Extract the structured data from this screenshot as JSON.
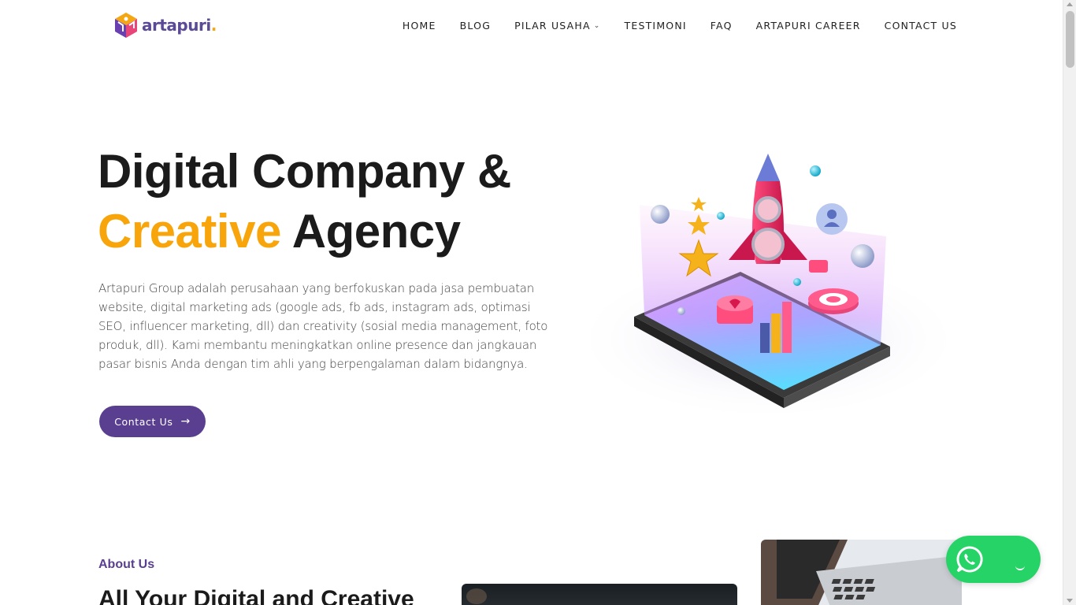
{
  "brand": {
    "name": "artapuri",
    "dot": ".",
    "logo_icon": "artapuri-cube-logo"
  },
  "nav": {
    "items": [
      {
        "label": "HOME"
      },
      {
        "label": "BLOG"
      },
      {
        "label": "PILAR USAHA",
        "has_dropdown": true
      },
      {
        "label": "TESTIMONI"
      },
      {
        "label": "FAQ"
      },
      {
        "label": "ARTAPURI CAREER"
      },
      {
        "label": "CONTACT US"
      }
    ],
    "dropdown_icon": "chevron-down-icon"
  },
  "hero": {
    "title_line1": "Digital Company &",
    "title_accent": "Creative",
    "title_rest": "Agency",
    "description": "Artapuri Group adalah perusahaan yang berfokuskan pada jasa pembuatan website, digital marketing ads (google ads, fb ads, instagram ads, optimasi SEO, influencer marketing, dll) dan creativity (sosial media management, foto produk, dll). Kami membantu meningkatkan online presence dan jangkauan pasar bisnis Anda dengan tim ahli yang berpengalaman dalam bidangnya.",
    "cta_label": "Contact Us",
    "cta_icon": "arrow-right-icon",
    "illustration": "rocket-on-tablet-illustration"
  },
  "about": {
    "label": "About Us",
    "heading": "All Your Digital and Creative"
  },
  "whatsapp": {
    "icon": "whatsapp-icon"
  },
  "colors": {
    "brand_purple": "#5a3f91",
    "accent_orange": "#f7a50b",
    "whatsapp_green": "#25d366",
    "text_dark": "#1b1b1b"
  }
}
